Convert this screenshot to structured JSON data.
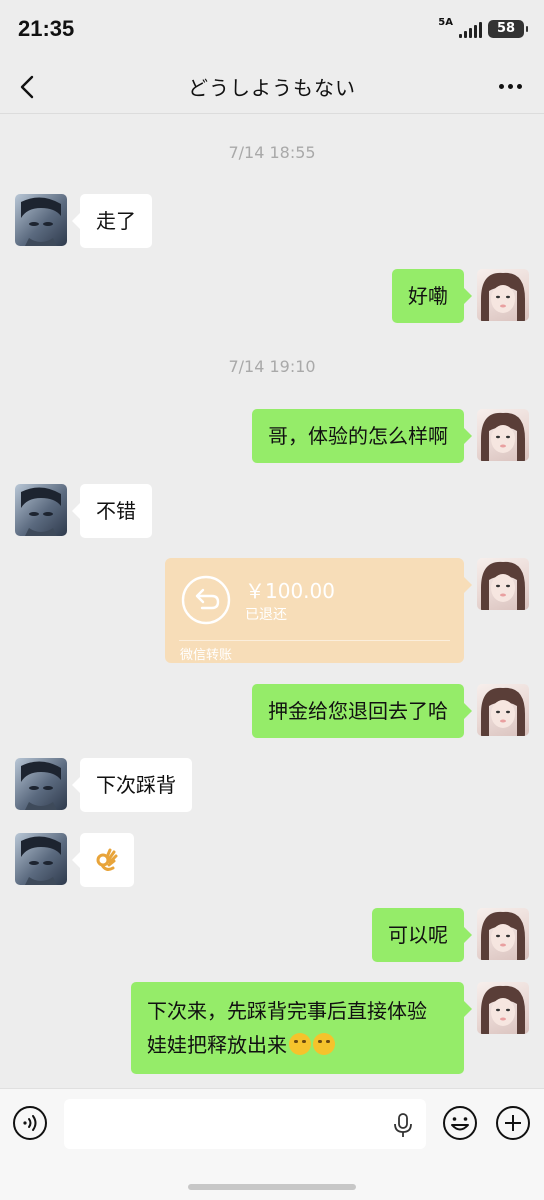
{
  "status_bar": {
    "time": "21:35",
    "network": "5A",
    "battery": "58"
  },
  "header": {
    "title": "どうしようもない"
  },
  "timestamps": [
    "7/14 18:55",
    "7/14 19:10"
  ],
  "messages": [
    {
      "sender": "other",
      "text": "走了"
    },
    {
      "sender": "me",
      "text": "好嘞"
    },
    {
      "sender": "me",
      "text": "哥，体验的怎么样啊"
    },
    {
      "sender": "other",
      "text": "不错"
    },
    {
      "sender": "me",
      "type": "transfer"
    },
    {
      "sender": "me",
      "text": "押金给您退回去了哈"
    },
    {
      "sender": "other",
      "text": "下次踩背"
    },
    {
      "sender": "other",
      "type": "emoji",
      "icon": "ok-hand-emoji"
    },
    {
      "sender": "me",
      "text": "可以呢"
    },
    {
      "sender": "me",
      "line1": "下次来，先踩背完事后直接体验",
      "line2": "娃娃把释放出来"
    }
  ],
  "transfer": {
    "amount": "￥100.00",
    "status": "已退还",
    "footer": "微信转账"
  },
  "colors": {
    "background": "#ededed",
    "bubble_me": "#95ec69",
    "bubble_other": "#ffffff",
    "transfer_card": "#f7ddb8"
  },
  "input": {
    "placeholder": ""
  }
}
